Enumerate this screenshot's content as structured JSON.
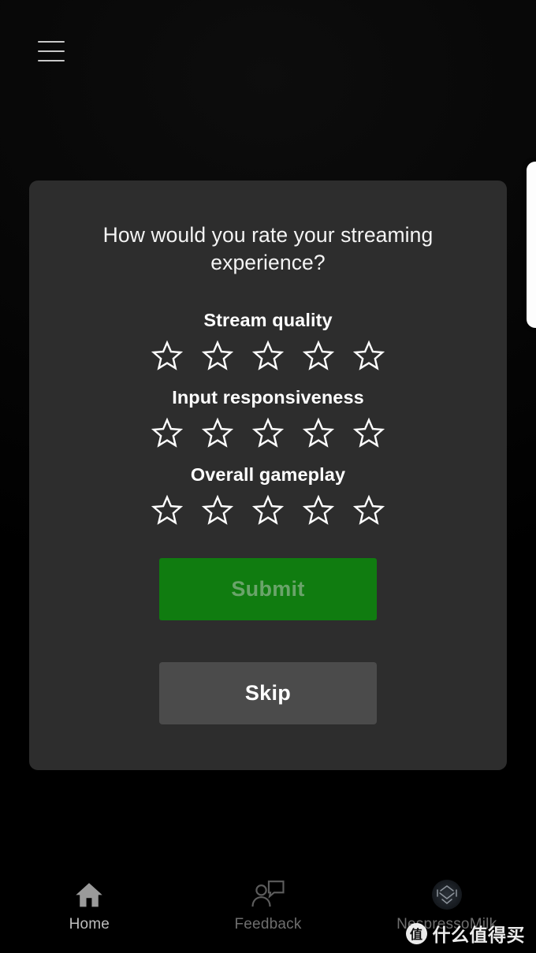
{
  "app": {
    "background_color": "#000000",
    "menu_icon": "hamburger-menu-icon"
  },
  "edge_panel": {
    "name": "partial-white-panel",
    "color": "#fdfdfd"
  },
  "card": {
    "background_color": "#2d2d2d",
    "title": "How would you rate your streaming experience?",
    "rating_groups": [
      {
        "label": "Stream quality",
        "max_stars": 5,
        "selected": 0,
        "star_icon": "star-outline-icon"
      },
      {
        "label": "Input responsiveness",
        "max_stars": 5,
        "selected": 0,
        "star_icon": "star-outline-icon"
      },
      {
        "label": "Overall gameplay",
        "max_stars": 5,
        "selected": 0,
        "star_icon": "star-outline-icon"
      }
    ],
    "submit": {
      "label": "Submit",
      "color": "#107c10",
      "text_color": "#6aa46a",
      "state": "disabled"
    },
    "skip": {
      "label": "Skip",
      "color": "#4b4b4b",
      "text_color": "#ffffff",
      "state": "enabled"
    }
  },
  "bottom_nav": {
    "items": [
      {
        "label": "Home",
        "icon": "home-icon",
        "state": "active"
      },
      {
        "label": "Feedback",
        "icon": "feedback-person-speech-bubble-icon",
        "state": "inactive"
      },
      {
        "label": "NespressoMilk",
        "icon": "user-avatar-icon",
        "state": "inactive"
      }
    ]
  },
  "watermark": {
    "badge": "值",
    "text": "什么值得买"
  }
}
